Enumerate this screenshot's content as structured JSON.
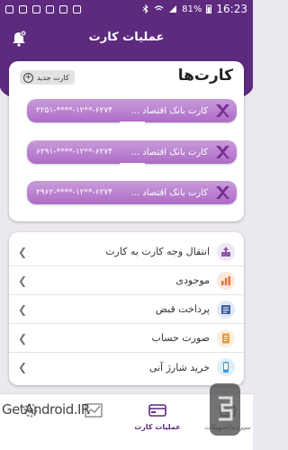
{
  "status_bar": {
    "battery": "81%",
    "time": "16:23"
  },
  "header": {
    "title": "عملیات کارت"
  },
  "cards_section": {
    "heading": "کارت‌ها",
    "new_card_label": "کارت جدید",
    "cards": [
      {
        "name": "کارت بانک اقتصاد ...",
        "number": "۲۲۵۱-****-۱۲**-۶۲۷۴"
      },
      {
        "name": "کارت بانک اقتصاد ...",
        "number": "۶۲۹۱-****-۱۲**-۶۲۷۴"
      },
      {
        "name": "کارت بانک اقتصاد ...",
        "number": "۲۹۶۲-****-۱۲**-۶۲۷۴"
      }
    ],
    "brand_color": "#ad6bc8"
  },
  "menu": {
    "items": [
      {
        "label": "انتقال وجه کارت به کارت",
        "icon": "card-transfer-icon",
        "color": "#8e5aa8"
      },
      {
        "label": "موجودی",
        "icon": "balance-chart-icon",
        "color": "#e8743b"
      },
      {
        "label": "پرداخت قبض",
        "icon": "bill-icon",
        "color": "#3b5fa8"
      },
      {
        "label": "صورت حساب",
        "icon": "statement-icon",
        "color": "#e79a3c"
      },
      {
        "label": "خرید شارژ آنی",
        "icon": "phone-charge-icon",
        "color": "#3a9bd4"
      }
    ]
  },
  "bottom_nav": {
    "items": [
      {
        "label": "سپرده/تسهیلات",
        "icon": "deposit-icon"
      },
      {
        "label": "عملیات کارت",
        "icon": "cards-icon",
        "active": true
      },
      {
        "label": "",
        "icon": "chart-icon"
      },
      {
        "label": "",
        "icon": "settings-gear-icon"
      }
    ]
  },
  "watermark": {
    "text": "GetAndroid.IR"
  },
  "colors": {
    "primary": "#5d2a7e",
    "background": "#ece8ef"
  }
}
